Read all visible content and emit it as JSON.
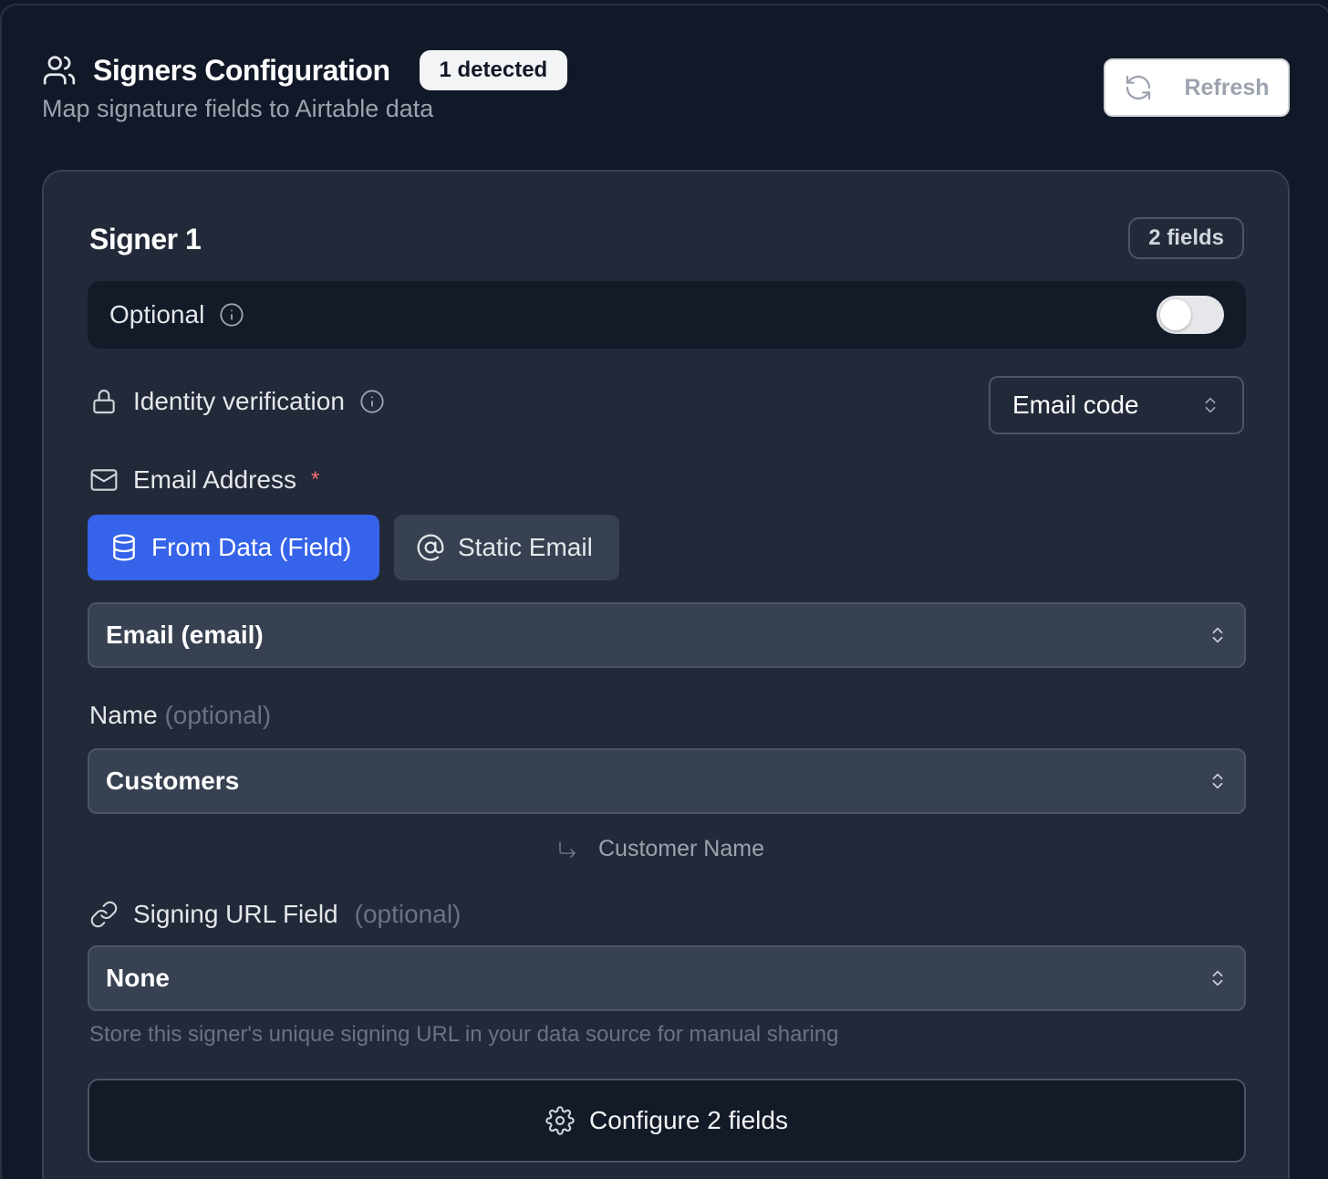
{
  "header": {
    "title": "Signers Configuration",
    "detected_badge": "1 detected",
    "subtitle": "Map signature fields to Airtable data",
    "refresh_label": "Refresh",
    "title_icon": "users-icon",
    "refresh_icon": "refresh-icon"
  },
  "signer": {
    "title": "Signer 1",
    "fields_badge": "2 fields",
    "optional": {
      "label": "Optional",
      "enabled": false
    },
    "identity_verification": {
      "label": "Identity verification",
      "value": "Email code"
    },
    "email": {
      "label": "Email Address",
      "required_mark": "*",
      "source_options": [
        {
          "label": "From Data (Field)",
          "active": true,
          "icon": "database-icon"
        },
        {
          "label": "Static Email",
          "active": false,
          "icon": "at-sign-icon"
        }
      ],
      "field_value": "Email (email)"
    },
    "name": {
      "label": "Name",
      "optional_hint": "(optional)",
      "table_value": "Customers",
      "field_value": "Customer Name"
    },
    "signing_url": {
      "label": "Signing URL Field",
      "optional_hint": "(optional)",
      "value": "None",
      "helper": "Store this signer's unique signing URL in your data source for manual sharing"
    },
    "configure_label": "Configure 2 fields"
  },
  "colors": {
    "page_bg": "#111827",
    "card_bg": "#222938",
    "accent": "#3563e9",
    "required": "#f87171"
  }
}
